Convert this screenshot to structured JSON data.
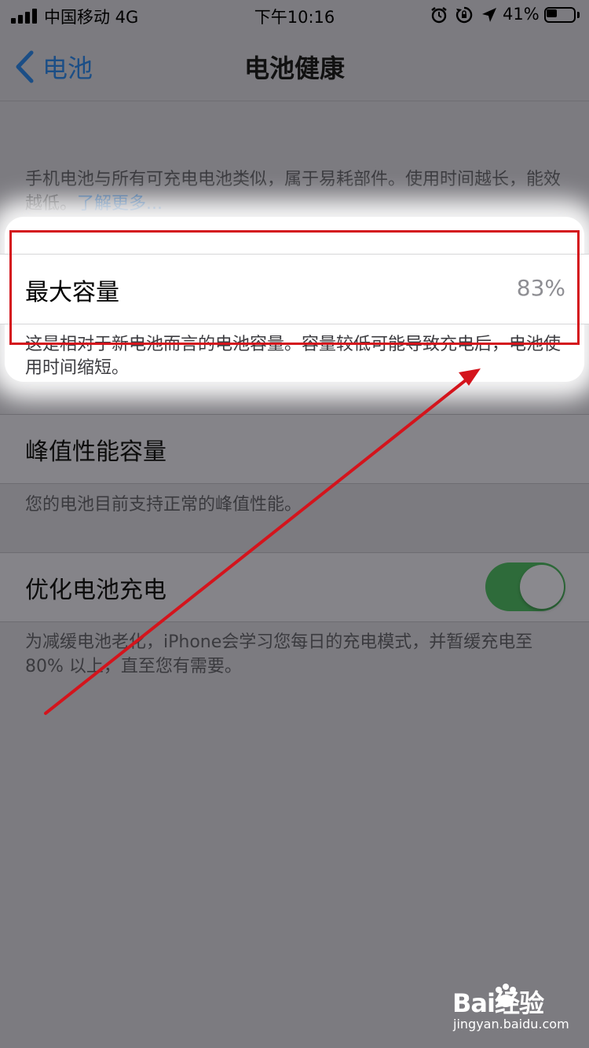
{
  "status_bar": {
    "carrier": "中国移动  4G",
    "time": "下午10:16",
    "battery_percent": "41%",
    "battery_level": 0.41,
    "icons": [
      "signal-icon",
      "alarm-icon",
      "rotation-lock-icon",
      "location-arrow-icon",
      "battery-icon"
    ]
  },
  "nav": {
    "back_label": "电池",
    "title": "电池健康"
  },
  "intro": {
    "text": "手机电池与所有可充电电池类似，属于易耗部件。使用时间越长，能效越低。",
    "link": "了解更多..."
  },
  "max_capacity": {
    "label": "最大容量",
    "value": "83%",
    "note": "这是相对于新电池而言的电池容量。容量较低可能导致充电后，电池使用时间缩短。"
  },
  "peak_performance": {
    "label": "峰值性能容量",
    "note": "您的电池目前支持正常的峰值性能。"
  },
  "optimized_charging": {
    "label": "优化电池充电",
    "enabled": true,
    "note": "为减缓电池老化，iPhone会学习您每日的充电模式，并暂缓充电至 80% 以上，直至您有需要。"
  },
  "watermark": {
    "brand": "Bai经验",
    "url": "jingyan.baidu.com"
  },
  "colors": {
    "annotation_red": "#d4141c",
    "toggle_on": "#2e6b3a",
    "link_blue": "#1b4e86"
  }
}
